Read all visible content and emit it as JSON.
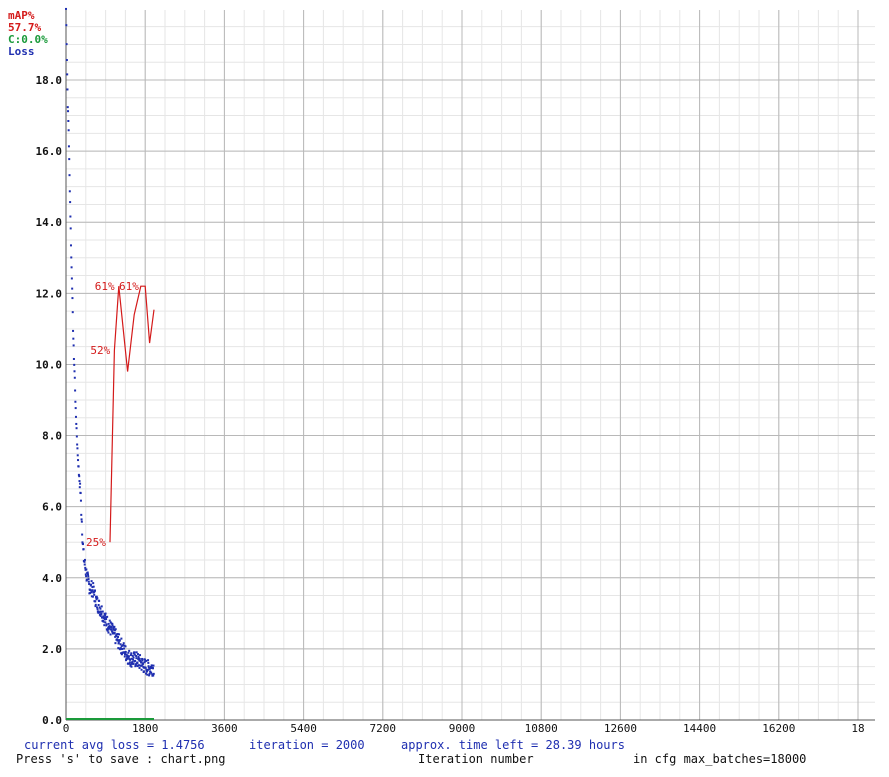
{
  "legend": {
    "map_label": "mAP%",
    "map_value": "57.7%",
    "c_label": "C:0.0%",
    "loss_label": "Loss",
    "colors": {
      "map": "#d41a1a",
      "c": "#1a9a3a",
      "loss": "#1f2fb0"
    }
  },
  "chart_data": {
    "type": "line",
    "xlabel": "Iteration number",
    "ylabel": "",
    "xlim": [
      0,
      18000
    ],
    "ylim": [
      0,
      20
    ],
    "grid": true,
    "x_ticks": [
      "0",
      "1800",
      "3600",
      "5400",
      "7200",
      "9000",
      "10800",
      "12600",
      "14400",
      "16200",
      "18"
    ],
    "y_ticks": [
      "0.0",
      "2.0",
      "4.0",
      "6.0",
      "8.0",
      "10.0",
      "12.0",
      "14.0",
      "16.0",
      "18.0"
    ],
    "series": [
      {
        "name": "Loss",
        "color": "#1f2fb0",
        "style": "dots",
        "x": [
          0,
          20,
          40,
          60,
          80,
          100,
          120,
          140,
          160,
          180,
          200,
          220,
          240,
          260,
          280,
          300,
          320,
          340,
          360,
          380,
          400,
          450,
          500,
          550,
          600,
          700,
          800,
          900,
          1000,
          1100,
          1200,
          1300,
          1400,
          1500,
          1600,
          1700,
          1800,
          1900,
          2000
        ],
        "values": [
          20.0,
          18.6,
          17.3,
          16.6,
          15.3,
          14.2,
          13.0,
          12.2,
          11.0,
          10.2,
          9.6,
          8.7,
          8.2,
          7.6,
          7.2,
          6.8,
          6.6,
          6.1,
          5.6,
          5.0,
          4.6,
          4.2,
          3.9,
          3.7,
          3.7,
          3.3,
          3.1,
          2.8,
          2.6,
          2.4,
          2.2,
          2.0,
          1.8,
          1.7,
          1.7,
          1.6,
          1.5,
          1.45,
          1.48
        ]
      },
      {
        "name": "mAP%",
        "color": "#d41a1a",
        "style": "line",
        "x": [
          1000,
          1100,
          1200,
          1300,
          1400,
          1550,
          1700,
          1800,
          1900,
          2000
        ],
        "values": [
          25,
          52,
          61,
          55,
          49,
          57,
          61,
          61,
          53,
          57.7
        ]
      },
      {
        "name": "C",
        "color": "#1a9a3a",
        "style": "line",
        "x": [
          0,
          2000
        ],
        "values": [
          0,
          0
        ]
      }
    ],
    "map_scale": "mAP% plotted on same axis as value/5",
    "annotations": [
      {
        "text": "25%",
        "x": 1000,
        "map": 25
      },
      {
        "text": "52%",
        "x": 1100,
        "map": 52
      },
      {
        "text": "61%",
        "x": 1200,
        "map": 61
      },
      {
        "text": "61%",
        "x": 1750,
        "map": 61
      }
    ]
  },
  "footer": {
    "avg_loss": "current avg loss = 1.4756",
    "iteration": "iteration = 2000",
    "time_left": "approx. time left = 28.39 hours",
    "save_hint": "Press 's' to save : chart.png",
    "xlabel": "Iteration number",
    "max_batches": "in cfg max_batches=18000"
  }
}
